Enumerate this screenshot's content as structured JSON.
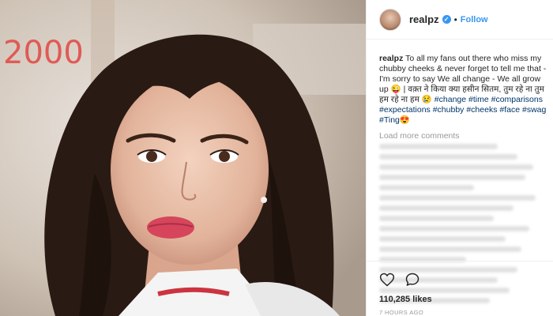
{
  "photo": {
    "year_label": "2000"
  },
  "header": {
    "username": "realpz",
    "separator": "•",
    "follow_label": "Follow"
  },
  "caption": {
    "username": "realpz",
    "text": "To all my fans out there who miss my chubby cheeks & never forget to tell me that - I'm sorry to say We all change - We all grow up 😜 | वक़्त ने किया क्या हसीन सितम, तुम रहे ना तुम हम रहे ना हम 😢",
    "hashtags": [
      "#change",
      "#time",
      "#comparisons",
      "#expectations",
      "#chubby",
      "#cheeks",
      "#face",
      "#swag",
      "#Ting😍"
    ]
  },
  "comments": {
    "load_more_label": "Load more comments"
  },
  "footer": {
    "likes": "110,285 likes",
    "time": "7 HOURS AGO"
  },
  "colors": {
    "link_blue": "#3897f0",
    "hashtag": "#003569",
    "year_label": "#e05a55"
  },
  "icons": [
    "verified-badge-icon",
    "heart-icon",
    "comment-icon"
  ]
}
